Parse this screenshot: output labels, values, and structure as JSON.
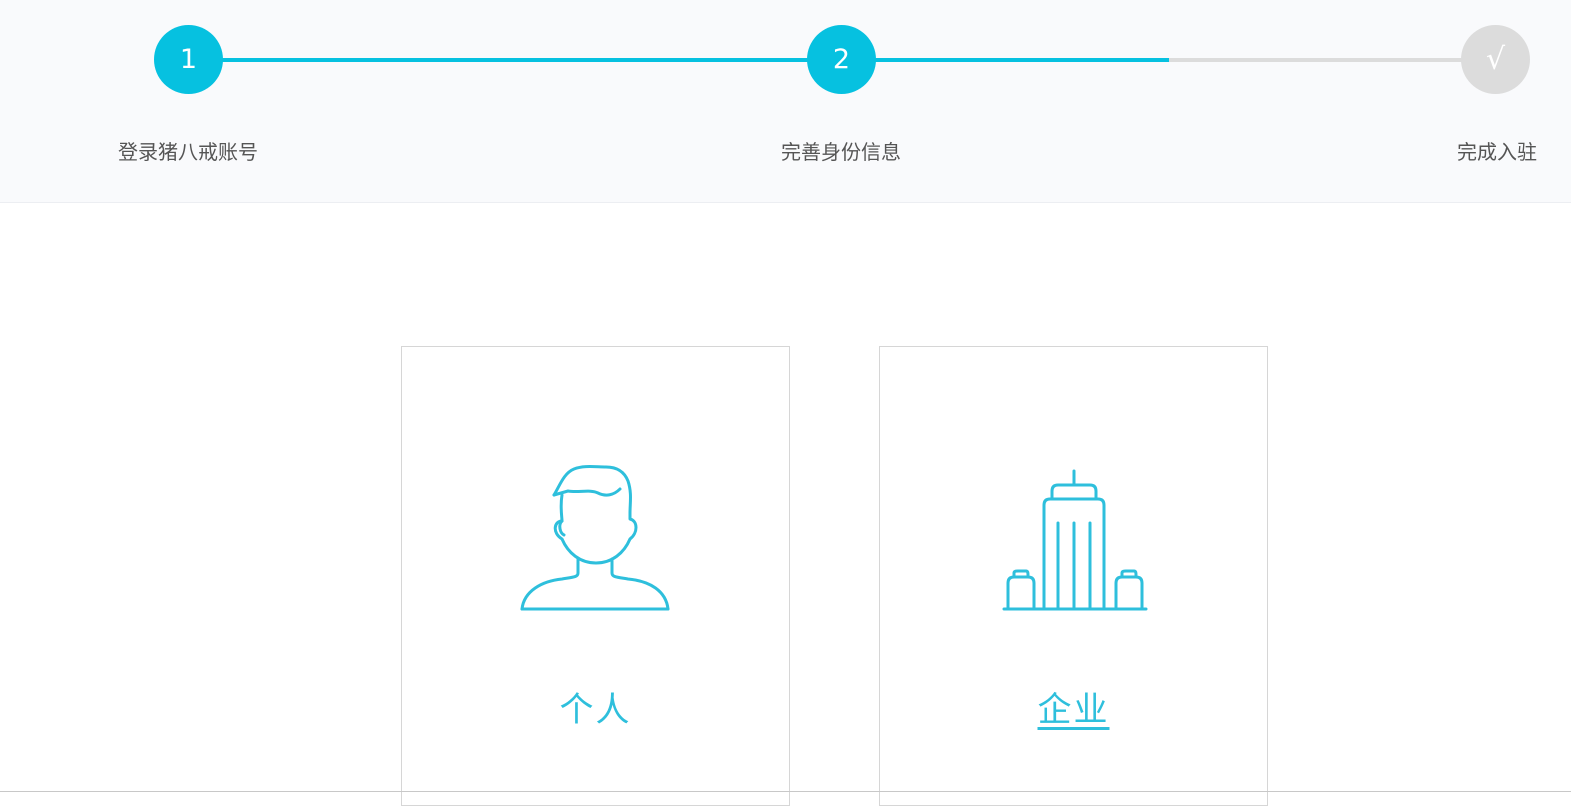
{
  "steps": [
    {
      "marker": "1",
      "label": "登录猪八戒账号",
      "state": "done"
    },
    {
      "marker": "2",
      "label": "完善身份信息",
      "state": "active"
    },
    {
      "marker": "√",
      "label": "完成入驻",
      "state": "pending"
    }
  ],
  "cards": {
    "personal": {
      "label": "个人",
      "icon": "person-icon"
    },
    "enterprise": {
      "label": "企业",
      "icon": "building-icon"
    }
  },
  "colors": {
    "accent": "#06c1e0",
    "inactive": "#dcdcdc",
    "icon_stroke": "#2ebfdc"
  }
}
